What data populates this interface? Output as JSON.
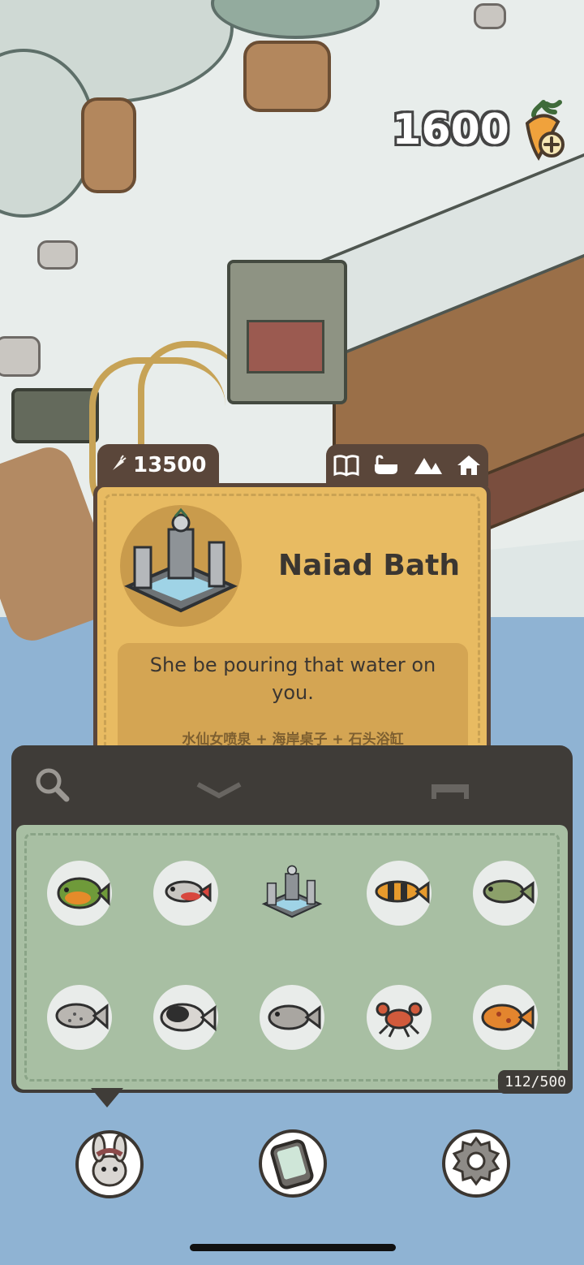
{
  "hud": {
    "carrots": "1600"
  },
  "card": {
    "price": "13500",
    "title": "Naiad Bath",
    "description": "She be pouring that water on you.",
    "recipe": "水仙女喷泉 + 海岸桌子 + 石头浴缸",
    "tabs": [
      "book-icon",
      "bathtub-icon",
      "mountain-icon",
      "house-icon"
    ]
  },
  "inventory": {
    "count": "112/500",
    "items": [
      "green-perch-fish",
      "red-tetra-fish",
      "naiad-bath-fountain",
      "black-orange-loach-fish",
      "green-carp-fish",
      "spotted-grey-fish",
      "black-koi-fish",
      "gray-bass-fish",
      "red-crab",
      "orange-spotted-fish"
    ]
  },
  "nav": [
    "rabbit-profile-icon",
    "phone-icon",
    "settings-gear-icon"
  ],
  "colors": {
    "card": "#e8bb62",
    "panel": "#3f3c38",
    "grid": "#a8bfa3",
    "water": "#8fb3d3"
  }
}
